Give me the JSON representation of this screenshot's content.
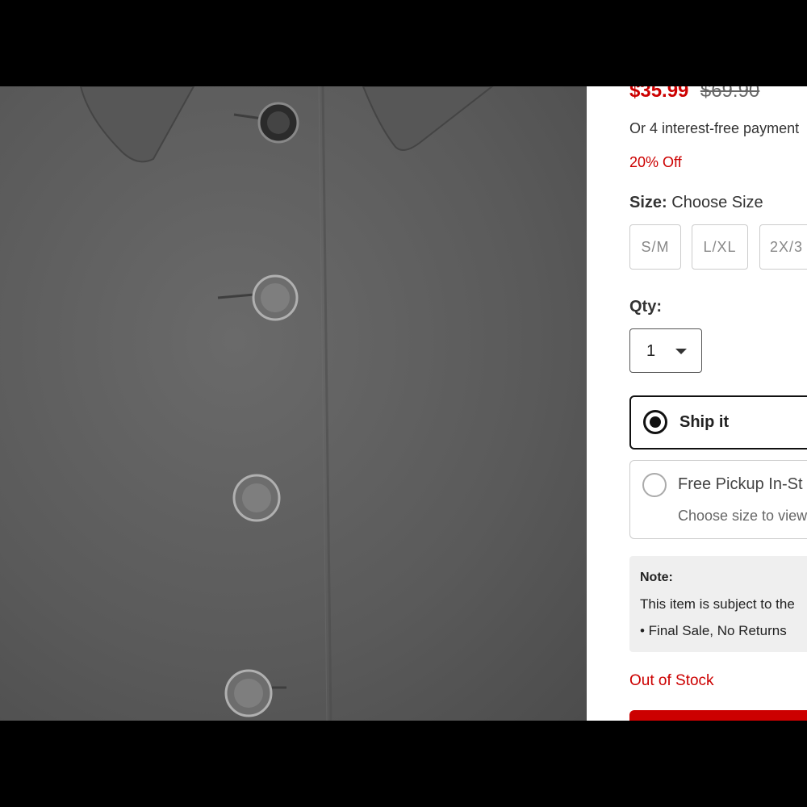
{
  "product": {
    "sale_price": "$35.99",
    "original_price": "$69.90",
    "installments_text": "Or 4 interest-free payment",
    "discount_text": "20% Off"
  },
  "size": {
    "label": "Size:",
    "value": "Choose Size",
    "options": [
      "S/M",
      "L/XL",
      "2X/3"
    ]
  },
  "quantity": {
    "label": "Qty:",
    "value": "1"
  },
  "fulfillment": {
    "ship_label": "Ship it",
    "pickup_label": "Free Pickup In-St",
    "pickup_sub": "Choose size to view",
    "selected": "ship"
  },
  "note": {
    "title": "Note:",
    "text": "This item is subject to the",
    "bullet": "• Final Sale, No Returns"
  },
  "stock_status": "Out of Stock",
  "colors": {
    "accent_red": "#cc0000",
    "photo_gray": "#5a5a5a"
  }
}
